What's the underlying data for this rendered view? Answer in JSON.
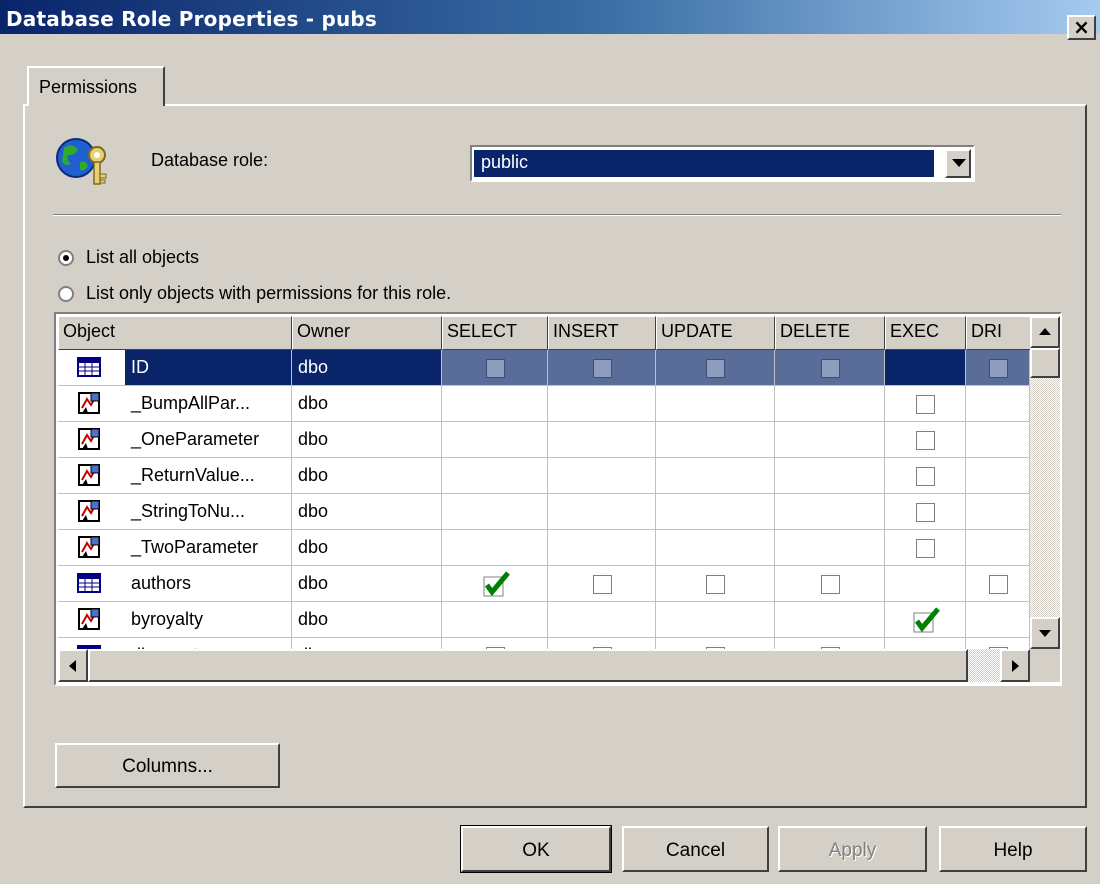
{
  "window": {
    "title": "Database Role Properties - pubs",
    "close_label": "×"
  },
  "tabs": [
    {
      "label": "Permissions"
    }
  ],
  "role": {
    "label": "Database role:",
    "value": "public"
  },
  "list_options": [
    {
      "label": "List all objects",
      "checked": true
    },
    {
      "label": "List only objects with permissions for this role.",
      "checked": false
    }
  ],
  "grid": {
    "columns": [
      "Object",
      "Owner",
      "SELECT",
      "INSERT",
      "UPDATE",
      "DELETE",
      "EXEC",
      "DRI"
    ],
    "rows": [
      {
        "icon": "table-icon",
        "name": "ID",
        "owner": "dbo",
        "select": "unchecked",
        "insert": "unchecked",
        "update": "unchecked",
        "delete": "unchecked",
        "exec": "none",
        "dri": "unchecked",
        "selected": true
      },
      {
        "icon": "stored-procedure-icon",
        "name": "_BumpAllPar...",
        "owner": "dbo",
        "select": "none",
        "insert": "none",
        "update": "none",
        "delete": "none",
        "exec": "unchecked",
        "dri": "none"
      },
      {
        "icon": "stored-procedure-icon",
        "name": "_OneParameter",
        "owner": "dbo",
        "select": "none",
        "insert": "none",
        "update": "none",
        "delete": "none",
        "exec": "unchecked",
        "dri": "none"
      },
      {
        "icon": "stored-procedure-icon",
        "name": "_ReturnValue...",
        "owner": "dbo",
        "select": "none",
        "insert": "none",
        "update": "none",
        "delete": "none",
        "exec": "unchecked",
        "dri": "none"
      },
      {
        "icon": "stored-procedure-icon",
        "name": "_StringToNu...",
        "owner": "dbo",
        "select": "none",
        "insert": "none",
        "update": "none",
        "delete": "none",
        "exec": "unchecked",
        "dri": "none"
      },
      {
        "icon": "stored-procedure-icon",
        "name": "_TwoParameter",
        "owner": "dbo",
        "select": "none",
        "insert": "none",
        "update": "none",
        "delete": "none",
        "exec": "unchecked",
        "dri": "none"
      },
      {
        "icon": "table-icon",
        "name": "authors",
        "owner": "dbo",
        "select": "checked",
        "insert": "unchecked",
        "update": "unchecked",
        "delete": "unchecked",
        "exec": "none",
        "dri": "unchecked"
      },
      {
        "icon": "stored-procedure-icon",
        "name": "byroyalty",
        "owner": "dbo",
        "select": "none",
        "insert": "none",
        "update": "none",
        "delete": "none",
        "exec": "checked",
        "dri": "none"
      },
      {
        "icon": "table-icon",
        "name": "discounts",
        "owner": "dbo",
        "select": "unchecked",
        "insert": "unchecked",
        "update": "unchecked",
        "delete": "unchecked",
        "exec": "none",
        "dri": "unchecked"
      }
    ]
  },
  "buttons": {
    "columns": "Columns...",
    "ok": "OK",
    "cancel": "Cancel",
    "apply": "Apply",
    "help": "Help"
  },
  "colors": {
    "title_bar": "#0a246a",
    "selection": "#0a246a",
    "check": "#008000",
    "face": "#d4d0c8"
  }
}
